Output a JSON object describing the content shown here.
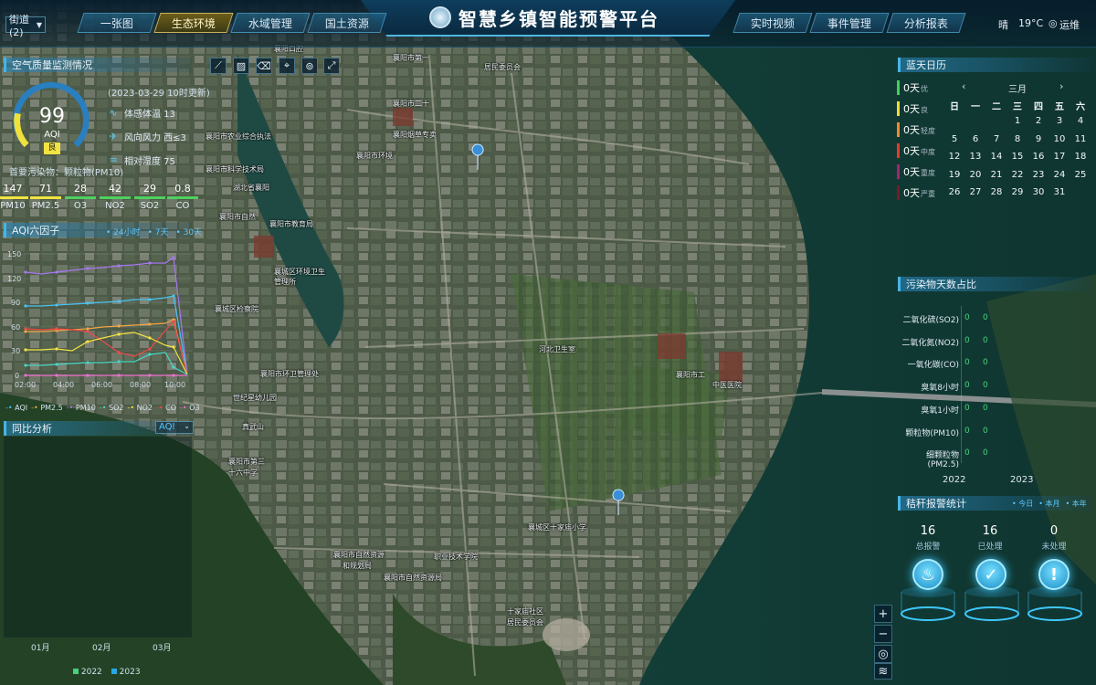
{
  "header": {
    "title": "智慧乡镇智能预警平台",
    "street_select": "街道(2)",
    "tabs_left": [
      {
        "label": "一张图",
        "active": false
      },
      {
        "label": "生态环境",
        "active": true
      },
      {
        "label": "水域管理",
        "active": false
      },
      {
        "label": "国土资源",
        "active": false
      }
    ],
    "tabs_right": [
      {
        "label": "实时视频"
      },
      {
        "label": "事件管理"
      },
      {
        "label": "分析报表"
      }
    ],
    "weather": "晴",
    "temperature": "19°C",
    "user": "运维"
  },
  "air": {
    "title": "空气质量监测情况",
    "aqi_value": "99",
    "aqi_label": "AQI",
    "level": "良",
    "timestamp": "(2023-03-29 10时更新)",
    "feels_like": "体感体温 13",
    "wind": "风向风力 西≤3",
    "humidity": "相对湿度 75",
    "primary_pollutant": "首要污染物：颗粒物(PM10)",
    "factors": [
      {
        "name": "PM10",
        "value": "147",
        "color": "#f2e341"
      },
      {
        "name": "PM2.5",
        "value": "71",
        "color": "#f2e341"
      },
      {
        "name": "O3",
        "value": "28",
        "color": "#4fd05f"
      },
      {
        "name": "NO2",
        "value": "42",
        "color": "#4fd05f"
      },
      {
        "name": "SO2",
        "value": "29",
        "color": "#4fd05f"
      },
      {
        "name": "CO",
        "value": "0.8",
        "color": "#4fd05f"
      }
    ]
  },
  "six": {
    "title": "AQI六因子",
    "ranges": [
      "24小时",
      "7天",
      "30天"
    ],
    "y_ticks": [
      "150",
      "120",
      "90",
      "60",
      "30",
      "0"
    ],
    "x_ticks": [
      "02:00",
      "04:00",
      "06:00",
      "08:00",
      "10:00"
    ],
    "legend": [
      "AQI",
      "PM2.5",
      "PM10",
      "SO2",
      "NO2",
      "CO",
      "O3"
    ]
  },
  "compare": {
    "title": "同比分析",
    "select": "AQI",
    "months": [
      "01月",
      "02月",
      "03月"
    ],
    "legend": [
      "2022",
      "2023"
    ]
  },
  "calendar": {
    "title": "蓝天日历",
    "month": "三月",
    "weekdays": [
      "日",
      "一",
      "二",
      "三",
      "四",
      "五",
      "六"
    ],
    "levels": [
      {
        "days": "0天",
        "label": "优",
        "color": "#3fd05a"
      },
      {
        "days": "0天",
        "label": "良",
        "color": "#f1d83a"
      },
      {
        "days": "0天",
        "label": "轻度",
        "color": "#f08a26"
      },
      {
        "days": "0天",
        "label": "中度",
        "color": "#e63a2a"
      },
      {
        "days": "0天",
        "label": "重度",
        "color": "#a0276e"
      },
      {
        "days": "0天",
        "label": "严重",
        "color": "#7a1a26"
      }
    ],
    "rows": [
      [
        "",
        "",
        "",
        "1",
        "2",
        "3",
        "4"
      ],
      [
        "5",
        "6",
        "7",
        "8",
        "9",
        "10",
        "11"
      ],
      [
        "12",
        "13",
        "14",
        "15",
        "16",
        "17",
        "18"
      ],
      [
        "19",
        "20",
        "21",
        "22",
        "23",
        "24",
        "25"
      ],
      [
        "26",
        "27",
        "28",
        "29",
        "30",
        "31",
        ""
      ]
    ]
  },
  "pollution": {
    "title": "污染物天数占比",
    "items": [
      {
        "name": "二氧化硫(SO2)",
        "v2022": "0",
        "v2023": "0"
      },
      {
        "name": "二氧化氮(NO2)",
        "v2022": "0",
        "v2023": "0"
      },
      {
        "name": "一氧化碳(CO)",
        "v2022": "0",
        "v2023": "0"
      },
      {
        "name": "臭氧8小时",
        "v2022": "0",
        "v2023": "0"
      },
      {
        "name": "臭氧1小时",
        "v2022": "0",
        "v2023": "0"
      },
      {
        "name": "颗粒物(PM10)",
        "v2022": "0",
        "v2023": "0"
      },
      {
        "name": "细颗粒物(PM2.5)",
        "v2022": "0",
        "v2023": "0"
      }
    ],
    "years": [
      "2022",
      "2023"
    ]
  },
  "alarm": {
    "title": "秸秆报警统计",
    "ranges": [
      "今日",
      "本月",
      "本年"
    ],
    "stats": [
      {
        "value": "16",
        "label": "总报警"
      },
      {
        "value": "16",
        "label": "已处理"
      },
      {
        "value": "0",
        "label": "未处理"
      }
    ]
  },
  "map_labels": [
    "襄阳口腔",
    "襄阳市第一",
    "居民委员会",
    "襄阳市二十",
    "襄阳市环境",
    "襄阳烟草专卖",
    "襄阳市农业综合执法",
    "襄阳市科学技术局",
    "湖北省襄阳",
    "襄阳市自然",
    "襄阳市教育局",
    "襄城区环境卫生",
    "管理所",
    "襄城区检察院",
    "襄阳市第三",
    "十六中学",
    "襄阳市自然资源",
    "和规划局",
    "十家庙社区",
    "居民委员会",
    "襄城区十家庙小学",
    "河北卫生室",
    "襄阳市环卫管理处",
    "襄阳市工",
    "中医医院",
    "世纪星幼儿园",
    "真武山",
    "职业技术学院",
    "襄阳市自然资源局"
  ],
  "colors": {
    "accent": "#47b4e6",
    "active_tab": "#c9b25a"
  }
}
